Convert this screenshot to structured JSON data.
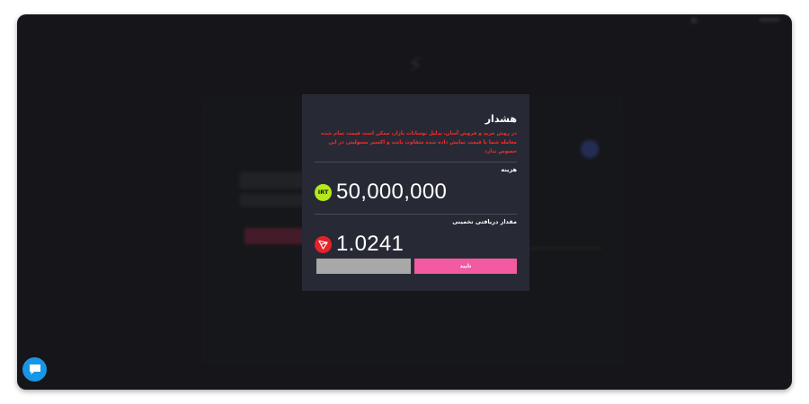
{
  "modal": {
    "title": "هشدار",
    "warning": "در روش خرید و فروش آسان، بدلیل نوسانات بازار، ممکن است قیمت تمام شده معامله شما با قیمت نمایش داده شده متفاوت باشد و اکسیر مسولیتی در این خصوص ندارد",
    "cost": {
      "label": "هزینه",
      "currency": "IRT",
      "amount": "50,000,000"
    },
    "estimate": {
      "label": "مقدار دریافتی تخمینی",
      "currency_icon": "tron-icon",
      "amount": "1.0241"
    },
    "confirm_label": "تایید",
    "cancel_label": ""
  },
  "colors": {
    "confirm": "#f25aa2",
    "warning": "#ff2a2a",
    "irt_coin": "#b4e91c",
    "trx_coin": "#e5222a",
    "chat": "#1796e6"
  }
}
